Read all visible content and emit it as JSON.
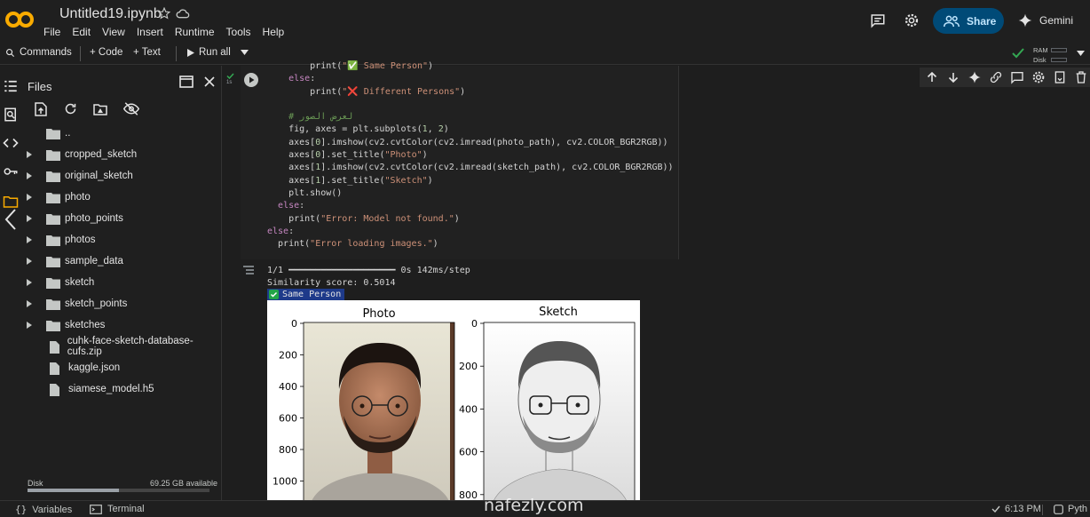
{
  "header": {
    "notebook_title": "Untitled19.ipynb",
    "menu": [
      "File",
      "Edit",
      "View",
      "Insert",
      "Runtime",
      "Tools",
      "Help"
    ],
    "share_label": "Share",
    "gemini_label": "Gemini",
    "logo_text": "CO"
  },
  "toolbar": {
    "commands_label": "Commands",
    "code_label": "+ Code",
    "text_label": "+ Text",
    "run_all_label": "Run all",
    "ram_label": "RAM",
    "disk_label": "Disk"
  },
  "files_panel": {
    "title": "Files",
    "items": [
      {
        "name": "..",
        "type": "parent"
      },
      {
        "name": "cropped_sketch",
        "type": "folder"
      },
      {
        "name": "original_sketch",
        "type": "folder"
      },
      {
        "name": "photo",
        "type": "folder"
      },
      {
        "name": "photo_points",
        "type": "folder"
      },
      {
        "name": "photos",
        "type": "folder"
      },
      {
        "name": "sample_data",
        "type": "folder"
      },
      {
        "name": "sketch",
        "type": "folder"
      },
      {
        "name": "sketch_points",
        "type": "folder"
      },
      {
        "name": "sketches",
        "type": "folder"
      },
      {
        "name": "cuhk-face-sketch-database-cufs.zip",
        "type": "file"
      },
      {
        "name": "kaggle.json",
        "type": "file"
      },
      {
        "name": "siamese_model.h5",
        "type": "file"
      }
    ],
    "disk_label": "Disk",
    "disk_available": "69.25 GB available",
    "disk_used_fraction": 0.5
  },
  "cell": {
    "exec_count": "1s",
    "code_lines": [
      "        print(\"✅ Same Person\")",
      "    else:",
      "        print(\"❌ Different Persons\")",
      "",
      "    # لعرض الصور",
      "    fig, axes = plt.subplots(1, 2)",
      "    axes[0].imshow(cv2.cvtColor(cv2.imread(photo_path), cv2.COLOR_BGR2RGB))",
      "    axes[0].set_title(\"Photo\")",
      "    axes[1].imshow(cv2.cvtColor(cv2.imread(sketch_path), cv2.COLOR_BGR2RGB))",
      "    axes[1].set_title(\"Sketch\")",
      "    plt.show()",
      "  else:",
      "    print(\"Error: Model not found.\")",
      "else:",
      "  print(\"Error loading images.\")"
    ]
  },
  "output": {
    "progress_line": "1/1 ━━━━━━━━━━━━━━━━━━━━ 0s 142ms/step",
    "similarity_line": "Similarity score: 0.5014",
    "result_label": "Same Person",
    "plot": {
      "left_title": "Photo",
      "right_title": "Sketch",
      "left_yticks": [
        "0",
        "200",
        "400",
        "600",
        "800",
        "1000"
      ],
      "right_yticks": [
        "0",
        "200",
        "400",
        "600",
        "800"
      ]
    }
  },
  "statusbar": {
    "variables_label": "Variables",
    "terminal_label": "Terminal",
    "time": "6:13 PM",
    "python_label": "Pyth"
  },
  "watermark": "nafezly.com",
  "colors": {
    "share_bg": "#004a77",
    "result_bg": "#1e3a8a",
    "check_green": "#22a447"
  }
}
